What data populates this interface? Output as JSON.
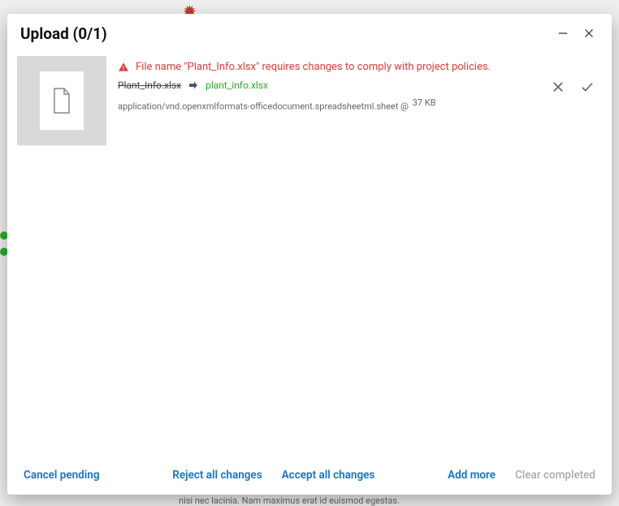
{
  "dialog": {
    "title": "Upload (0/1)"
  },
  "file": {
    "warning_text": "File name \"Plant_Info.xlsx\" requires changes to comply with project policies.",
    "old_name": "Plant_Info.xlsx",
    "new_name": "plant_info.xlsx",
    "mime": "application/vnd.openxmlformats-officedocument.spreadsheetml.sheet @",
    "size": "37 KB"
  },
  "footer": {
    "cancel_pending": "Cancel pending",
    "reject_all": "Reject all changes",
    "accept_all": "Accept all changes",
    "add_more": "Add more",
    "clear_completed": "Clear completed"
  },
  "background": {
    "lorem": "nisi nec lacinia. Nam maximus erat id euismod egestas."
  }
}
